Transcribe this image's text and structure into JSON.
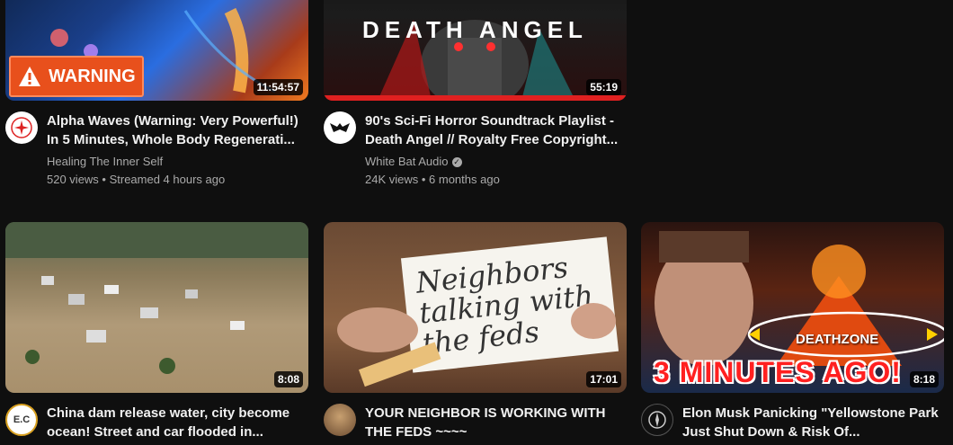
{
  "videos": [
    {
      "title": "Alpha Waves (Warning: Very Powerful!) In 5 Minutes, Whole Body Regenerati...",
      "channel": "Healing The Inner Self",
      "stats": "520 views • Streamed 4 hours ago",
      "duration": "11:54:57",
      "overlay": "WARNING",
      "verified": false
    },
    {
      "title": "90's Sci-Fi Horror Soundtrack Playlist - Death Angel // Royalty Free Copyright...",
      "channel": "White Bat Audio",
      "stats": "24K views • 6 months ago",
      "duration": "55:19",
      "overlay": "DEATH ANGEL",
      "verified": true
    },
    {
      "title": "China dam release water, city become ocean! Street and car flooded in...",
      "channel": "",
      "stats": "",
      "duration": "8:08",
      "avatar_text": "E.C"
    },
    {
      "title": "YOUR NEIGHBOR IS WORKING WITH THE FEDS ~~~~",
      "channel": "",
      "stats": "",
      "duration": "17:01",
      "overlay": "Neighbors talking with the feds"
    },
    {
      "title": "Elon Musk Panicking \"Yellowstone Park Just Shut Down & Risk Of...",
      "channel": "",
      "stats": "",
      "duration": "8:18",
      "overlay": "3 MINUTES AGO!",
      "overlay2": "DEATHZONE"
    }
  ],
  "colors": {
    "background": "#0f0f0f",
    "title": "#f1f1f1",
    "secondary": "#aaaaaa",
    "warning": "#e8501c",
    "alert_red": "#ff2020"
  }
}
